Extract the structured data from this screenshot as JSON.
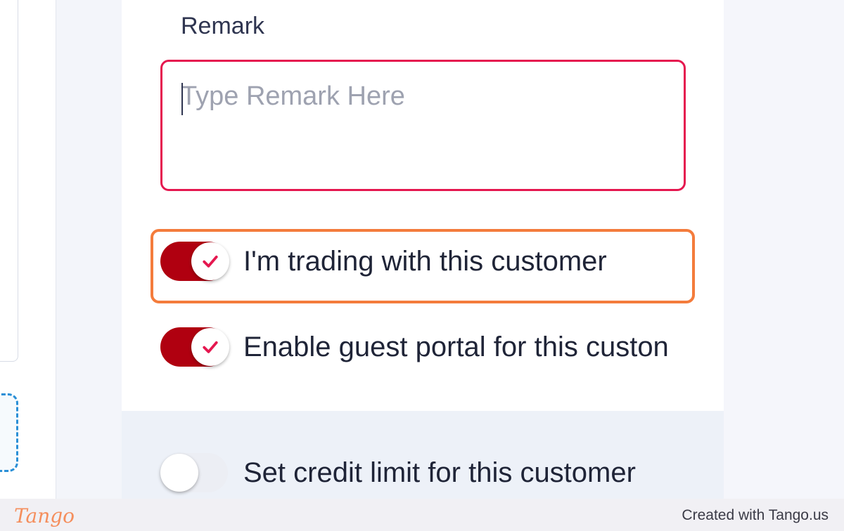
{
  "form": {
    "remark": {
      "label": "Remark",
      "placeholder": "Type Remark Here",
      "value": ""
    },
    "toggles": [
      {
        "label": "I'm trading with this customer",
        "checked": true
      },
      {
        "label": "Enable guest portal for this custon",
        "checked": true
      },
      {
        "label": "Set credit limit for this customer",
        "checked": false
      }
    ]
  },
  "footer": {
    "brand": "Tango",
    "credit": "Created with Tango.us"
  },
  "colors": {
    "toggle_on": "#b00010",
    "check": "#e5174f",
    "focus_border": "#e5174f",
    "highlight": "#f47c3c"
  }
}
